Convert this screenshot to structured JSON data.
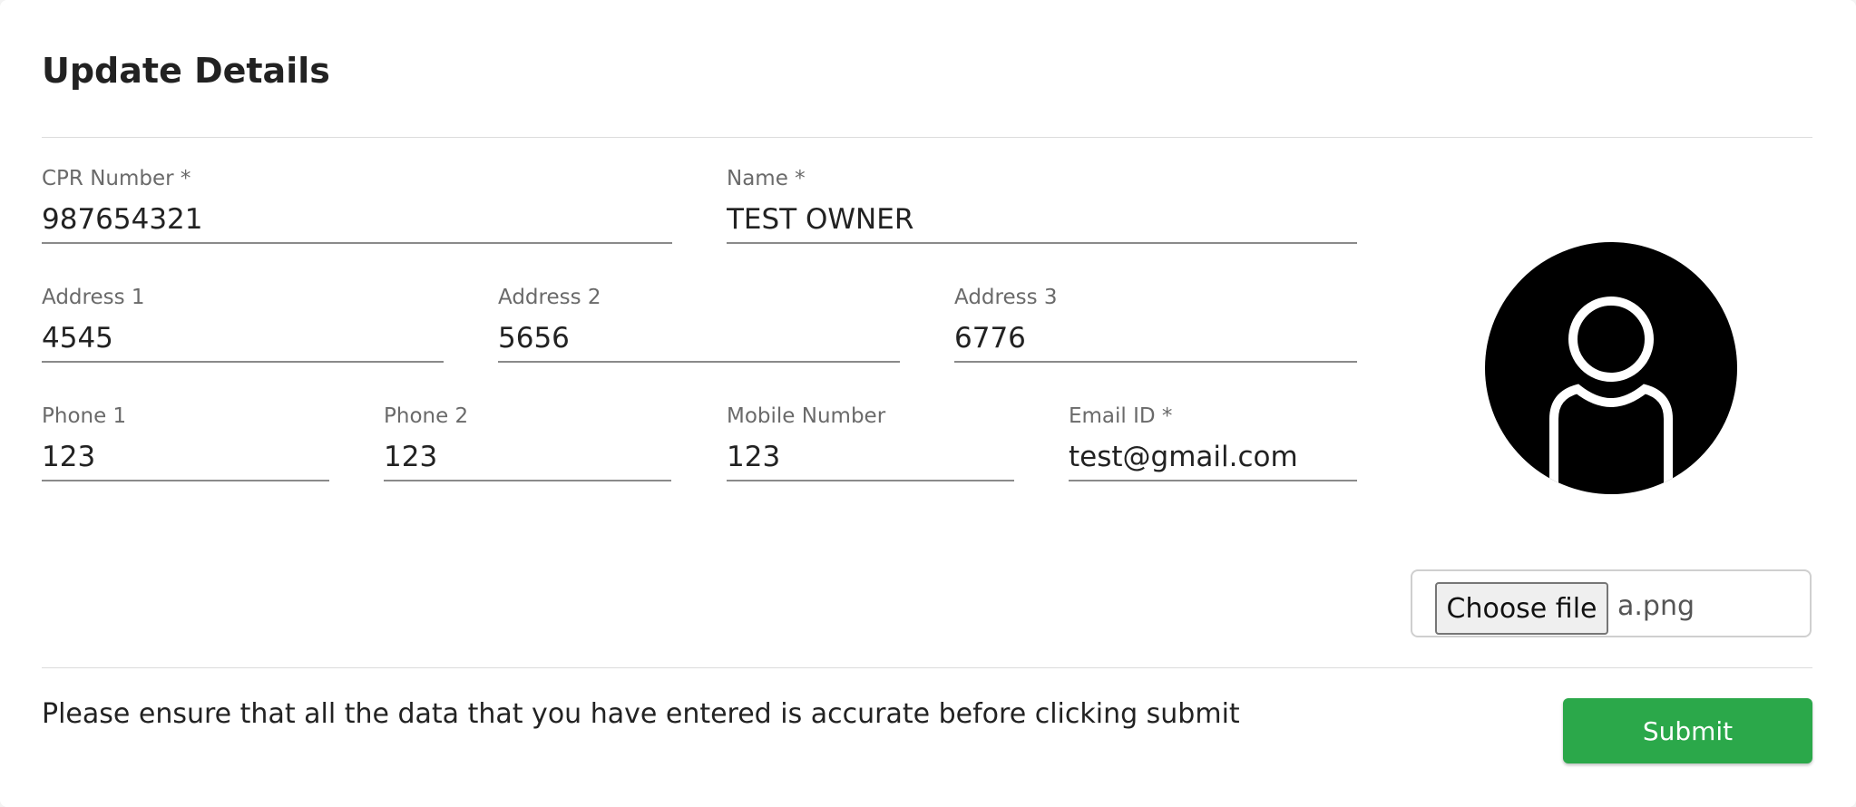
{
  "header": {
    "title": "Update Details"
  },
  "form": {
    "cpr": {
      "label": "CPR Number *",
      "value": "987654321"
    },
    "name": {
      "label": "Name *",
      "value": "TEST OWNER"
    },
    "address1": {
      "label": "Address 1",
      "value": "4545"
    },
    "address2": {
      "label": "Address 2",
      "value": "5656"
    },
    "address3": {
      "label": "Address 3",
      "value": "6776"
    },
    "phone1": {
      "label": "Phone 1",
      "value": "123"
    },
    "phone2": {
      "label": "Phone 2",
      "value": "123"
    },
    "mobile": {
      "label": "Mobile Number",
      "value": "123"
    },
    "email": {
      "label": "Email ID *",
      "value": "test@gmail.com"
    }
  },
  "upload": {
    "avatar_icon": "user-avatar-icon",
    "choose_label": "Choose file",
    "file_name": "a.png"
  },
  "footer": {
    "notice": "Please ensure that all the data that you have entered is accurate before clicking submit",
    "submit_label": "Submit"
  },
  "colors": {
    "accent": "#2ba84a",
    "avatar": "#000000"
  }
}
